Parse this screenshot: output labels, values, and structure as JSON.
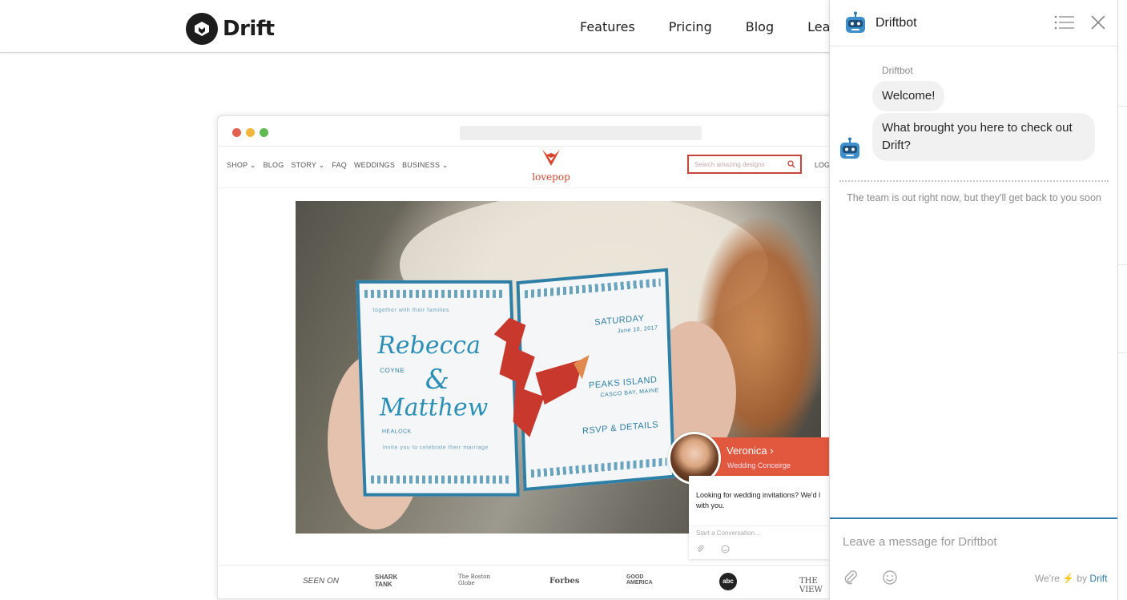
{
  "site": {
    "logo_text": "Drift",
    "nav": [
      "Features",
      "Pricing",
      "Blog",
      "Learn"
    ]
  },
  "mockup": {
    "store_nav": [
      "SHOP ⌄",
      "BLOG",
      "STORY ⌄",
      "FAQ",
      "WEDDINGS",
      "BUSINESS ⌄"
    ],
    "store_logo": "lovepop",
    "search_placeholder": "Search amazing designs",
    "login": "LOG",
    "card": {
      "intro": "together with their families",
      "name_1": "Rebecca",
      "surname_1": "COYNE",
      "ampersand": "&",
      "name_2": "Matthew",
      "surname_2": "HEALOCK",
      "invite": "invite you to celebrate their marriage",
      "day": "SATURDAY",
      "date": "June 10, 2017",
      "location": "PEAKS ISLAND",
      "location_sub": "CASCO BAY, MAINE",
      "rsvp": "RSVP & DETAILS"
    },
    "seen_on": [
      "SEEN ON",
      "SHARK TANK",
      "The Boston Globe",
      "Forbes",
      "GOOD AMERICA",
      "abc",
      "THE VIEW"
    ],
    "concierge": {
      "name": "Veronica ›",
      "role": "Wedding Conceirge",
      "message": "Looking for wedding invitations? We'd l with you.",
      "input_placeholder": "Start a Conversation..."
    }
  },
  "widget": {
    "title": "Driftbot",
    "sender": "Driftbot",
    "messages": [
      "Welcome!",
      "What brought you here to check out Drift?"
    ],
    "away_notice": "The team is out right now, but they'll get back to you soon",
    "input_placeholder": "Leave a message for Driftbot",
    "branding_prefix": "We're",
    "branding_by": "by",
    "branding_name": "Drift"
  },
  "colors": {
    "accent": "#2f7ab0",
    "concierge": "#e2583e",
    "lovepop": "#d9442c",
    "card_blue": "#2e7fa6"
  }
}
